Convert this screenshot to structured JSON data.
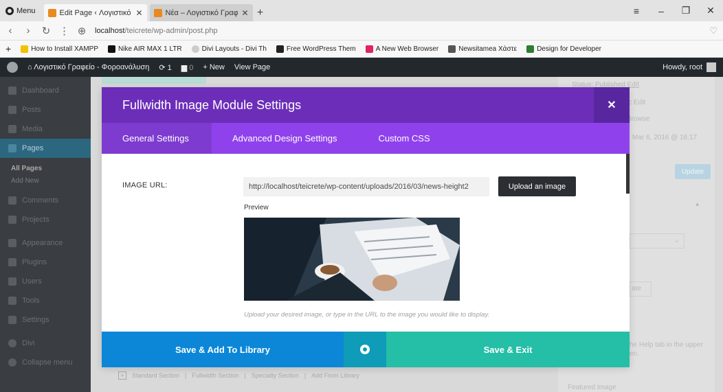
{
  "browser": {
    "menu_label": "Menu",
    "tabs": [
      {
        "title": "Edit Page ‹ Λογιστικό Γραφ"
      },
      {
        "title": "Νέα – Λογιστικό Γραφείο"
      }
    ],
    "url_host": "localhost",
    "url_path": "/teicrete/wp-admin/post.php",
    "bookmarks": [
      {
        "label": "How to Install XAMPP",
        "color": "#f2c200"
      },
      {
        "label": "Nike AIR MAX 1 LTR",
        "color": "#111111"
      },
      {
        "label": "Divi Layouts - Divi Th",
        "color": "#cccccc"
      },
      {
        "label": "Free WordPress Them",
        "color": "#222222"
      },
      {
        "label": "A New Web Browser",
        "color": "#e0245e"
      },
      {
        "label": "Newsitamea Χάστε",
        "color": "#555555"
      },
      {
        "label": "Design for Developer",
        "color": "#2e7d32"
      }
    ]
  },
  "wpbar": {
    "site_name": "Λογιστικό Γραφείο - Φοροανάλυση",
    "updates": "1",
    "comments": "0",
    "new_label": "New",
    "view_label": "View Page",
    "howdy": "Howdy, root"
  },
  "sidebar": {
    "items": [
      {
        "label": "Dashboard"
      },
      {
        "label": "Posts"
      },
      {
        "label": "Media"
      },
      {
        "label": "Pages"
      },
      {
        "label": "All Pages"
      },
      {
        "label": "Add New"
      },
      {
        "label": "Comments"
      },
      {
        "label": "Projects"
      },
      {
        "label": "Appearance"
      },
      {
        "label": "Plugins"
      },
      {
        "label": "Users"
      },
      {
        "label": "Tools"
      },
      {
        "label": "Settings"
      },
      {
        "label": "Divi"
      },
      {
        "label": "Collapse menu"
      }
    ]
  },
  "right_box": {
    "status": "Status: Published",
    "edit1": "Edit",
    "visibility": "ic Edit",
    "browse": "Browse",
    "date": "Mar 6, 2016 @ 16:17",
    "update": "Update",
    "template_suffix": "ate",
    "help": "he Help tab in the upper",
    "help2": "en.",
    "featured": "Featured Image"
  },
  "bottom_links": {
    "standard": "Standard Section",
    "fullwidth": "Fullwidth Section",
    "specialty": "Specialty Section",
    "library": "Add From Library"
  },
  "modal": {
    "title": "Fullwidth Image Module Settings",
    "tabs": [
      {
        "label": "General Settings"
      },
      {
        "label": "Advanced Design Settings"
      },
      {
        "label": "Custom CSS"
      }
    ],
    "image_url_label": "IMAGE URL:",
    "image_url_value": "http://localhost/teicrete/wp-content/uploads/2016/03/news-height2",
    "upload_label": "Upload an image",
    "preview_label": "Preview",
    "description": "Upload your desired image, or type in the URL to the image you would like to display.",
    "save_library": "Save & Add To Library",
    "save_exit": "Save & Exit",
    "colors": {
      "header": "#6c2eb9",
      "tabs": "#8f42ec",
      "save_library": "#0c87d7",
      "save_exit": "#25bea6"
    }
  }
}
